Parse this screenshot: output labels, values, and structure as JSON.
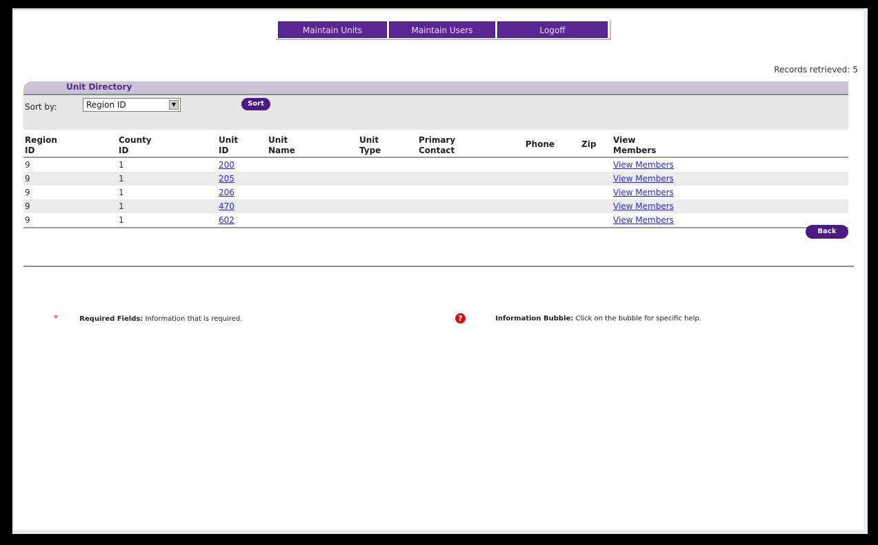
{
  "nav": {
    "maintain_units": "Maintain Units",
    "maintain_users": "Maintain Users",
    "logoff": "Logoff"
  },
  "records": {
    "label": "Records retrieved:",
    "count": "5"
  },
  "directory": {
    "title": "Unit Directory",
    "sort_label": "Sort by:",
    "sort_value": "Region ID",
    "sort_button": "Sort",
    "columns": {
      "region_id": [
        "Region",
        "ID"
      ],
      "county_id": [
        "County",
        "ID"
      ],
      "unit_id": [
        "Unit",
        "ID"
      ],
      "unit_name": [
        "Unit",
        "Name"
      ],
      "unit_type": [
        "Unit",
        "Type"
      ],
      "primary_contact": [
        "Primary",
        "Contact"
      ],
      "phone": "Phone",
      "zip": "Zip",
      "view_members": [
        "View",
        "Members"
      ]
    },
    "rows": [
      {
        "region_id": "9",
        "county_id": "1",
        "unit_id": "200",
        "unit_name": "",
        "unit_type": "",
        "primary_contact": "",
        "phone": "",
        "zip": "",
        "view_members": "View Members"
      },
      {
        "region_id": "9",
        "county_id": "1",
        "unit_id": "205",
        "unit_name": "",
        "unit_type": "",
        "primary_contact": "",
        "phone": "",
        "zip": "",
        "view_members": "View Members"
      },
      {
        "region_id": "9",
        "county_id": "1",
        "unit_id": "206",
        "unit_name": "",
        "unit_type": "",
        "primary_contact": "",
        "phone": "",
        "zip": "",
        "view_members": "View Members"
      },
      {
        "region_id": "9",
        "county_id": "1",
        "unit_id": "470",
        "unit_name": "",
        "unit_type": "",
        "primary_contact": "",
        "phone": "",
        "zip": "",
        "view_members": "View Members"
      },
      {
        "region_id": "9",
        "county_id": "1",
        "unit_id": "602",
        "unit_name": "",
        "unit_type": "",
        "primary_contact": "",
        "phone": "",
        "zip": "",
        "view_members": "View Members"
      }
    ],
    "back_button": "Back"
  },
  "legend": {
    "required_symbol": "*",
    "required_label": "Required Fields:",
    "required_text": "Information that is required.",
    "info_symbol": "?",
    "info_label": "Information Bubble:",
    "info_text": "Click on the bubble for specific help."
  },
  "colors": {
    "nav_purple": "#5b2693",
    "button_purple": "#4a1a82",
    "header_band": "#ccc2d6",
    "link_blue": "#2a2ad0",
    "required_red": "#e00000"
  }
}
